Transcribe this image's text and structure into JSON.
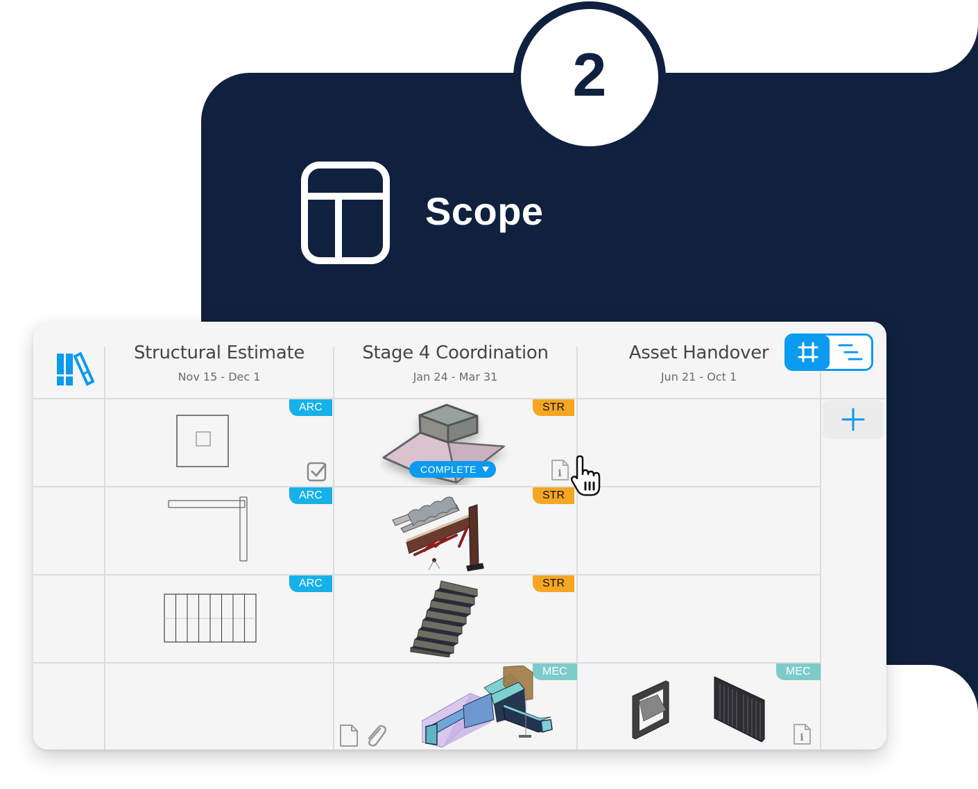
{
  "step": {
    "number": "2"
  },
  "section": {
    "title": "Scope",
    "icon": "layout-panels-icon"
  },
  "colors": {
    "navy": "#10203f",
    "accent_blue": "#0a9aef",
    "tag_arc": "#15b1e8",
    "tag_str": "#f5a623",
    "tag_mec": "#7ecbcb"
  },
  "board": {
    "library_icon": "library-books-icon",
    "view_toggle": {
      "selected": "grid",
      "options": [
        "grid-view-icon",
        "list-view-icon"
      ]
    },
    "add_label": "+",
    "columns": [
      {
        "title": "Structural Estimate",
        "dates": "Nov 15 - Dec 1"
      },
      {
        "title": "Stage 4 Coordination",
        "dates": "Jan 24 - Mar 31"
      },
      {
        "title": "Asset Handover",
        "dates": "Jun 21 - Oct 1"
      }
    ],
    "rows": [
      {
        "cells": [
          {
            "tag": "ARC",
            "item": "square-slab-drawing",
            "icons": [
              "checkbox-checked-icon"
            ]
          },
          {
            "tag": "STR",
            "item": "roof-hopper-3d-model",
            "status": "COMPLETE",
            "icons": [
              "info-document-icon"
            ]
          },
          null
        ]
      },
      {
        "cells": [
          {
            "tag": "ARC",
            "item": "l-shaped-wall-drawing"
          },
          {
            "tag": "STR",
            "item": "steel-frame-3d-model"
          },
          null
        ]
      },
      {
        "cells": [
          {
            "tag": "ARC",
            "item": "stair-plan-drawing"
          },
          {
            "tag": "STR",
            "item": "concrete-stair-3d-model"
          },
          null
        ]
      },
      {
        "cells": [
          null,
          {
            "tag": "MEC",
            "item": "duct-assembly-3d-model",
            "icons": [
              "document-icon",
              "paperclip-icon"
            ]
          },
          {
            "tag": "MEC",
            "item": "vent-grilles-3d-model",
            "icons": [
              "info-document-icon"
            ]
          }
        ]
      }
    ],
    "cursor": "hand-pointer-icon"
  }
}
